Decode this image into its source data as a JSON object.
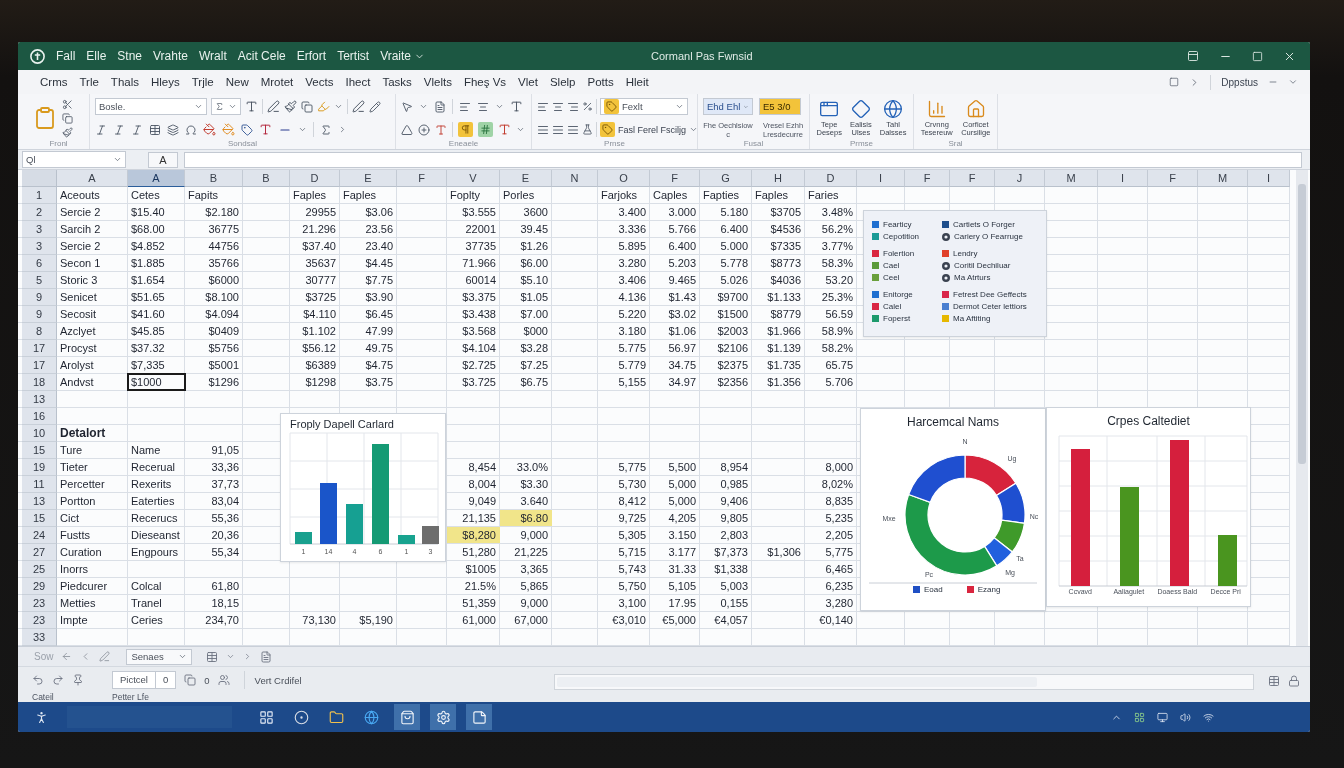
{
  "title_bar": {
    "menus": [
      "Fall",
      "Elle",
      "Stne",
      "Vrahte",
      "Wralt",
      "Acit Cele",
      "Erfort",
      "Tertist"
    ],
    "dropdown_menu": "Vraite",
    "title": "Cormanl Pas Fwnsid"
  },
  "ribbon_tabs": [
    "Crms",
    "Trle",
    "Thals",
    "Hleys",
    "Trjle",
    "New",
    "Mrotet",
    "Vects",
    "Ihect",
    "Tasks",
    "Vlelts",
    "Fheş Vs",
    "Vlet",
    "Slelp",
    "Potts",
    "Hleit"
  ],
  "account": "Dppstus",
  "ribbon": {
    "group_labels": [
      "Fronl",
      "Sondsal",
      "Eneaele",
      "Prnse",
      "Fusal",
      "Prmse",
      "Sral"
    ],
    "font_box": "Bosle.",
    "style_box": "Fexlt",
    "format_menu": "Fasl Ferel Fsciljg",
    "cell_style_box": "Ehd Ehl",
    "cell_style_caption": "Fhe Oechlsiow c",
    "highlight_box": "E5 3/0",
    "highlight_caption": "Vresel Ezhh Lresdecurre",
    "large_buttons": [
      {
        "kind": "window",
        "label": "Tepe Deseps"
      },
      {
        "kind": "shape",
        "label": "Ealisis Ulses"
      },
      {
        "kind": "globe",
        "label": "Tahl Dalsses"
      },
      {
        "kind": "chart",
        "label": "Crvnng Tesereuw"
      },
      {
        "kind": "house",
        "label": "Corficet Cursilige"
      }
    ]
  },
  "formula_bar": {
    "name_box": "Ql",
    "function_button": "A"
  },
  "sheet": {
    "columns": [
      {
        "label": "A",
        "selected": false
      },
      {
        "label": "A",
        "selected": true
      },
      {
        "label": "B",
        "selected": false
      },
      {
        "label": "B",
        "selected": false
      },
      {
        "label": "D",
        "selected": false
      },
      {
        "label": "E",
        "selected": false
      },
      {
        "label": "F",
        "selected": false
      },
      {
        "label": "V",
        "selected": false
      },
      {
        "label": "E",
        "selected": false
      },
      {
        "label": "N",
        "selected": false
      },
      {
        "label": "O",
        "selected": false
      },
      {
        "label": "F",
        "selected": false
      },
      {
        "label": "G",
        "selected": false
      },
      {
        "label": "H",
        "selected": false
      },
      {
        "label": "D",
        "selected": false
      },
      {
        "label": "I",
        "selected": false
      },
      {
        "label": "F",
        "selected": false
      },
      {
        "label": "F",
        "selected": false
      },
      {
        "label": "J",
        "selected": false
      },
      {
        "label": "M",
        "selected": false
      },
      {
        "label": "I",
        "selected": false
      },
      {
        "label": "F",
        "selected": false
      },
      {
        "label": "M",
        "selected": false
      },
      {
        "label": "I",
        "selected": false
      }
    ],
    "rows": [
      {
        "number": "1",
        "cells": [
          "Aceouts",
          "Cetes",
          "Fapits",
          null,
          "Faples",
          "Faples",
          null,
          "Foplty",
          "Porles",
          null,
          "Farjoks",
          "Caples",
          "Fapties",
          "Faples",
          "Faries"
        ]
      },
      {
        "number": "2",
        "cells": [
          "Sercie 2",
          "$15.40",
          "$2.180",
          null,
          "29955",
          "$3.06",
          null,
          "$3.555",
          "3600",
          null,
          "3.400",
          "3.000",
          "5.180",
          "$3705",
          "3.48%"
        ]
      },
      {
        "number": "3",
        "cells": [
          "Sarcih 2",
          "$68.00",
          "36775",
          null,
          "21.296",
          "23.56",
          null,
          "22001",
          "39.45",
          null,
          "3.336",
          "5.766",
          "6.400",
          "$4536",
          "56.2%"
        ]
      },
      {
        "number": "3",
        "cells": [
          "Sercie 2",
          "$4.852",
          "44756",
          null,
          "$37.40",
          "23.40",
          null,
          "37735",
          "$1.26",
          null,
          "5.895",
          "6.400",
          "5.000",
          "$7335",
          "3.77%"
        ]
      },
      {
        "number": "6",
        "cells": [
          "Secon 1",
          "$1.885",
          "35766",
          null,
          "35637",
          "$4.45",
          null,
          "71.966",
          "$6.00",
          null,
          "3.280",
          "5.203",
          "5.778",
          "$8773",
          "58.3%"
        ]
      },
      {
        "number": "5",
        "cells": [
          "Storic 3",
          "$1.654",
          "$6000",
          null,
          "30777",
          "$7.75",
          null,
          "60014",
          "$5.10",
          null,
          "3.406",
          "9.465",
          "5.026",
          "$4036",
          "53.20"
        ]
      },
      {
        "number": "9",
        "cells": [
          "Senicet",
          "$51.65",
          "$8.100",
          null,
          "$3725",
          "$3.90",
          null,
          "$3.375",
          "$1.05",
          null,
          "4.136",
          "$1.43",
          "$9700",
          "$1.133",
          "25.3%"
        ]
      },
      {
        "number": "9",
        "cells": [
          "Secosit",
          "$41.60",
          "$4.094",
          null,
          "$4.110",
          "$6.45",
          null,
          "$3.438",
          "$7.00",
          null,
          "5.220",
          "$3.02",
          "$1500",
          "$8779",
          "56.59"
        ]
      },
      {
        "number": "8",
        "cells": [
          "Azclyet",
          "$45.85",
          "$0409",
          null,
          "$1.102",
          "47.99",
          null,
          "$3.568",
          "$000",
          null,
          "3.180",
          "$1.06",
          "$2003",
          "$1.966",
          "58.9%"
        ]
      },
      {
        "number": "17",
        "cells": [
          "Procyst",
          "$37.32",
          "$5756",
          null,
          "$56.12",
          "49.75",
          null,
          "$4.104",
          "$3.28",
          null,
          "5.775",
          "56.97",
          "$2106",
          "$1.139",
          "58.2%"
        ]
      },
      {
        "number": "17",
        "cells": [
          "Arolyst",
          "$7,335",
          "$5001",
          null,
          "$6389",
          "$4.75",
          null,
          "$2.725",
          "$7.25",
          null,
          "5.779",
          "34.75",
          "$2375",
          "$1.735",
          "65.75"
        ]
      },
      {
        "number": "18",
        "cells": [
          "Andvst",
          {
            "kind": "active",
            "text": "$1000"
          },
          "$1296",
          null,
          "$1298",
          "$3.75",
          null,
          "$3.725",
          "$6.75",
          null,
          "5,155",
          "34.97",
          "$2356",
          "$1.356",
          "5.706"
        ]
      },
      {
        "number": "13"
      },
      {
        "number": "16"
      },
      {
        "number": "10",
        "cells": [
          {
            "kind": "heading",
            "text": "Detalort"
          }
        ]
      },
      {
        "number": "15",
        "cells": [
          "Ture",
          "Name",
          "91,05"
        ]
      },
      {
        "number": "19",
        "cells": [
          "Tieter",
          "Recerual",
          "33,36",
          null,
          null,
          null,
          null,
          "8,454",
          "33.0%",
          null,
          "5,775",
          "5,500",
          "8,954",
          null,
          "8,000"
        ]
      },
      {
        "number": "11",
        "cells": [
          "Percetter",
          "Rexerits",
          "37,73",
          null,
          null,
          null,
          null,
          "8,004",
          "$3.30",
          null,
          "5,730",
          "5,000",
          "0,985",
          null,
          "8,02%"
        ]
      },
      {
        "number": "13",
        "cells": [
          "Portton",
          "Eaterties",
          "83,04",
          null,
          null,
          null,
          null,
          "9,049",
          "3.640",
          null,
          "8,412",
          "5,000",
          "9,406",
          null,
          "8,835"
        ]
      },
      {
        "number": "15",
        "cells": [
          "Cict",
          "Recerucs",
          "55,36",
          null,
          null,
          null,
          null,
          "21,135",
          {
            "kind": "highlight",
            "text": "$6.80"
          },
          null,
          "9,725",
          "4,205",
          "9,805",
          null,
          "5,235"
        ]
      },
      {
        "number": "24",
        "cells": [
          "Fustts",
          "Dieseanst",
          "20,36",
          null,
          null,
          null,
          null,
          {
            "kind": "highlight",
            "text": "$8,280"
          },
          "9,000",
          null,
          "5,305",
          "3.150",
          "2,803",
          null,
          "2,205"
        ]
      },
      {
        "number": "27",
        "cells": [
          "Curation",
          "Engpours",
          "55,34",
          null,
          null,
          null,
          null,
          "51,280",
          "21,225",
          null,
          "5,715",
          "3.177",
          "$7,373",
          "$1,306",
          "5,775"
        ]
      },
      {
        "number": "25",
        "cells": [
          "Inorrs",
          null,
          null,
          null,
          null,
          null,
          null,
          "$1005",
          "3,365",
          null,
          "5,743",
          "31.33",
          "$1,338",
          null,
          "6,465"
        ]
      },
      {
        "number": "29",
        "cells": [
          "Piedcurer",
          "Colcal",
          "61,80",
          null,
          null,
          null,
          null,
          "21.5%",
          "5,865",
          null,
          "5,750",
          "5,105",
          "5,003",
          null,
          "6,235"
        ]
      },
      {
        "number": "23",
        "cells": [
          "Metties",
          "Tranel",
          "18,15",
          null,
          null,
          null,
          null,
          "51,359",
          "9,000",
          null,
          "3,100",
          "17.95",
          "0,155",
          null,
          "3,280"
        ]
      },
      {
        "number": "23",
        "cells": [
          "Impte",
          "Ceries",
          "234,70",
          null,
          "73,130",
          "$5,190",
          null,
          "61,000",
          "67,000",
          null,
          "€3,010",
          "€5,000",
          "€4,057",
          null,
          "€0,140"
        ]
      },
      {
        "number": "33"
      }
    ]
  },
  "legend": {
    "groups": [
      {
        "items": [
          {
            "label": "Fearticy",
            "kind": "swatch",
            "color": "#1f6fd0"
          },
          {
            "label": "Cartiets O Forger",
            "kind": "swatch",
            "color": "#1e4e8c"
          },
          {
            "label": "Cepotition",
            "kind": "swatch",
            "color": "#1a9a96"
          },
          {
            "label": "Cariery O Fearruge",
            "kind": "glyph",
            "color": "#3a4250"
          }
        ]
      },
      {
        "items": [
          {
            "label": "Folertion",
            "kind": "swatch",
            "color": "#d9263f"
          },
          {
            "label": "Lendry",
            "kind": "swatch",
            "color": "#e0402a"
          },
          {
            "label": "Cael",
            "kind": "swatch",
            "color": "#5a9a3a"
          },
          {
            "label": "Coritil Dechiluar",
            "kind": "glyph",
            "color": "#3a4250"
          },
          {
            "label": "Ceel",
            "kind": "swatch",
            "color": "#6aa03c"
          },
          {
            "label": "Ma Atrturs",
            "kind": "glyph",
            "color": "#3a4250"
          }
        ]
      },
      {
        "items": [
          {
            "label": "Enitorge",
            "kind": "swatch",
            "color": "#1f6fd0"
          },
          {
            "label": "Fetrest Dee Geffects",
            "kind": "swatch",
            "color": "#d9264a"
          },
          {
            "label": "Calel",
            "kind": "swatch",
            "color": "#d92644"
          },
          {
            "label": "Dermot Ceter lettiors",
            "kind": "swatch",
            "color": "#4a7fd0"
          },
          {
            "label": "Foperst",
            "kind": "swatch",
            "color": "#1d9a6c"
          },
          {
            "label": "Ma Aftiting",
            "kind": "swatch",
            "color": "#e6b800"
          }
        ]
      }
    ]
  },
  "bar_chart": {
    "title": "Froply Dapell Carlard",
    "x_labels": [
      "1",
      "14",
      "4",
      "6",
      "1",
      "3"
    ]
  },
  "donut_chart": {
    "title": "Harcemcal Nams",
    "data_labels": [
      "N",
      "Ug",
      "Nc",
      "Mxe",
      "Ta",
      "Mg",
      "Pc"
    ],
    "legend": [
      {
        "label": "Eoad",
        "color": "#1f4fc4"
      },
      {
        "label": "Ezang",
        "color": "#d9263f"
      }
    ]
  },
  "column_chart": {
    "title": "Crpes Caltediet",
    "x_labels": [
      "Ccvavd",
      "Aaliagulet",
      "Doaess Bald",
      "Decce Pri"
    ]
  },
  "sheet_bar": {
    "status": "Sow",
    "sheet_picker": "Senaes"
  },
  "bottom_toolbar": {
    "field": "Pictcel",
    "field_count": "0",
    "indicator": "0",
    "button": "Vert Crdifel",
    "captions": [
      "Cateil",
      "Petter Lfe"
    ]
  },
  "taskbar": {
    "apps": [
      {
        "kind": "grid",
        "active": false
      },
      {
        "kind": "browser",
        "active": false
      },
      {
        "kind": "folder",
        "active": false
      },
      {
        "kind": "edge",
        "active": false
      },
      {
        "kind": "store",
        "active": true
      },
      {
        "kind": "settings",
        "active": true
      },
      {
        "kind": "notes",
        "active": true
      }
    ]
  }
}
